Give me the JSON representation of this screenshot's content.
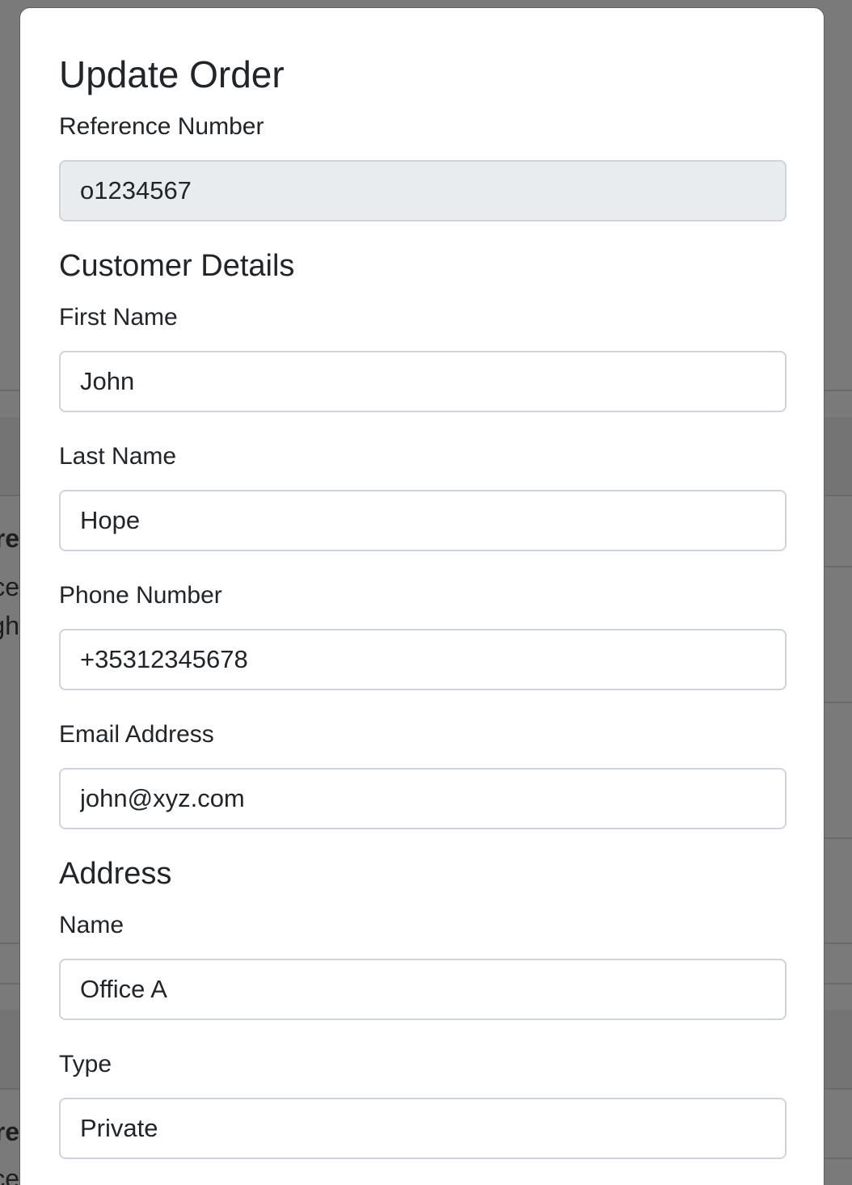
{
  "background": {
    "fragments": [
      "re",
      "ce",
      "gh",
      "re",
      "ce"
    ]
  },
  "modal": {
    "title": "Update Order",
    "reference": {
      "label": "Reference Number",
      "value": "o1234567"
    },
    "customer_details": {
      "heading": "Customer Details",
      "first_name": {
        "label": "First Name",
        "value": "John"
      },
      "last_name": {
        "label": "Last Name",
        "value": "Hope"
      },
      "phone": {
        "label": "Phone Number",
        "value": "+35312345678"
      },
      "email": {
        "label": "Email Address",
        "value": "john@xyz.com"
      }
    },
    "address": {
      "heading": "Address",
      "name": {
        "label": "Name",
        "value": "Office A"
      },
      "type": {
        "label": "Type",
        "value": "Private"
      }
    }
  }
}
